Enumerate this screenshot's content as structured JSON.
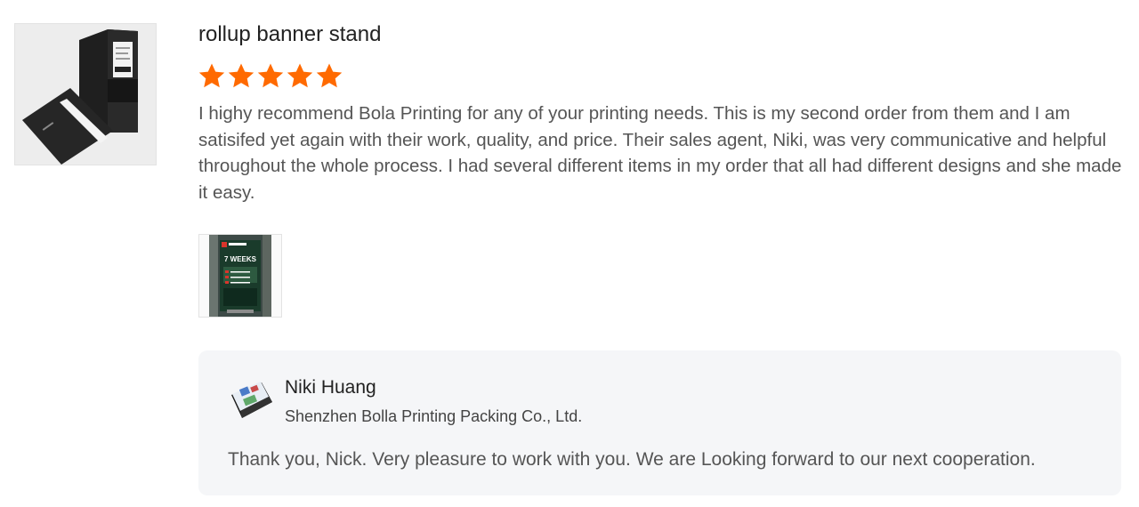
{
  "product": {
    "title": "rollup banner stand",
    "thumbnail_icon": "folder-product-image"
  },
  "review": {
    "rating": 5,
    "rating_max": 5,
    "star_color": "#ff6a00",
    "text": "I highy recommend Bola Printing for any of your printing needs.  This is my second order from them and I am satisifed yet again with their work, quality, and price.  Their sales agent, Niki, was very communicative and helpful throughout the whole process.  I had several different items in my order that all had different designs and she made it easy.",
    "photo_icon": "banner-stand-photo",
    "photo_caption": "7 WEEKS"
  },
  "reply": {
    "name": "Niki Huang",
    "company": "Shenzhen Bolla Printing Packing Co., Ltd.",
    "text": "Thank you, Nick. Very pleasure to work with you. We are Looking forward to our next cooperation.",
    "avatar_icon": "book-avatar"
  }
}
